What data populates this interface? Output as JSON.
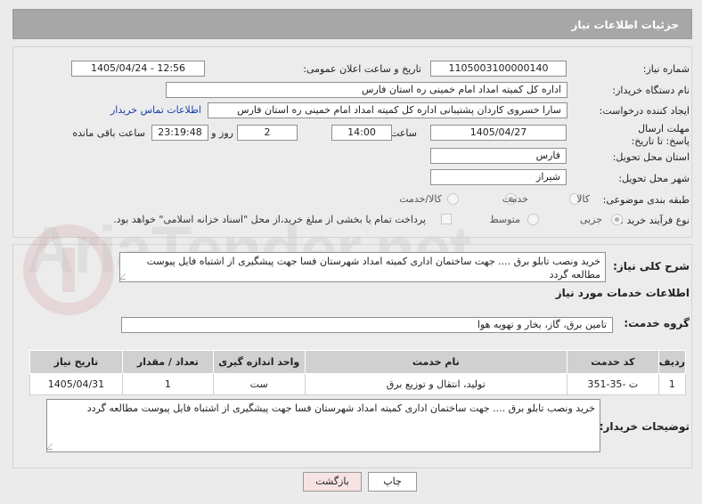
{
  "header": {
    "title": "جزئیات اطلاعات نیاز"
  },
  "form": {
    "need_number_label": "شماره نیاز:",
    "need_number": "1105003100000140",
    "announce_label": "تاریخ و ساعت اعلان عمومی:",
    "announce_value": "1405/04/24 - 12:56",
    "buyer_org_label": "نام دستگاه خریدار:",
    "buyer_org": "اداره کل کمیته امداد امام خمینی  ره  استان فارس",
    "creator_label": "ایجاد کننده درخواست:",
    "creator": "سارا خسروی کاردان پشتیبانی  اداره کل کمیته امداد امام خمینی  ره  استان فارس",
    "contact_link": "اطلاعات تماس خریدار",
    "deadline_label": "مهلت ارسال پاسخ: تا تاریخ:",
    "deadline_date": "1405/04/27",
    "time_label": "ساعت",
    "deadline_time": "14:00",
    "days_value": "2",
    "days_label": "روز و",
    "remaining_time": "23:19:48",
    "remaining_label": "ساعت باقی مانده",
    "province_label": "استان محل تحویل:",
    "province": "فارس",
    "city_label": "شهر محل تحویل:",
    "city": "شیراز",
    "category_label": "طبقه بندی موضوعی:",
    "category_options": [
      "کالا",
      "خدمت",
      "کالا/خدمت"
    ],
    "process_label": "نوع فرآیند خرید :",
    "process_options": [
      "جزیی",
      "متوسط"
    ],
    "payment_note": "پرداخت تمام یا بخشی از مبلغ خرید،از محل \"اسناد خزانه اسلامی\" خواهد بود."
  },
  "details": {
    "summary_label": "شرح کلی نیاز:",
    "summary": "خرید ونصب تابلو برق .... جهت ساختمان اداری کمیته امداد شهرستان فسا جهت پیشگیری از اشتباه فایل پیوست مطالعه گردد",
    "services_title": "اطلاعات خدمات مورد نیاز",
    "service_group_label": "گروه خدمت:",
    "service_group": "تامین برق، گاز، بخار و تهویه هوا",
    "table": {
      "headers": [
        "ردیف",
        "کد خدمت",
        "نام خدمت",
        "واحد اندازه گیری",
        "تعداد / مقدار",
        "تاریخ نیاز"
      ],
      "rows": [
        [
          "1",
          "ت -35-351",
          "تولید، انتقال و توزیع برق",
          "ست",
          "1",
          "1405/04/31"
        ]
      ]
    },
    "buyer_notes_label": "توضیحات خریدار:",
    "buyer_notes": "خرید ونصب تابلو برق .... جهت ساختمان اداری کمیته امداد شهرستان فسا جهت پیشگیری از اشتباه فایل پیوست مطالعه گردد"
  },
  "buttons": {
    "print": "چاپ",
    "back": "بازگشت"
  },
  "watermark": "AriaTender.net"
}
